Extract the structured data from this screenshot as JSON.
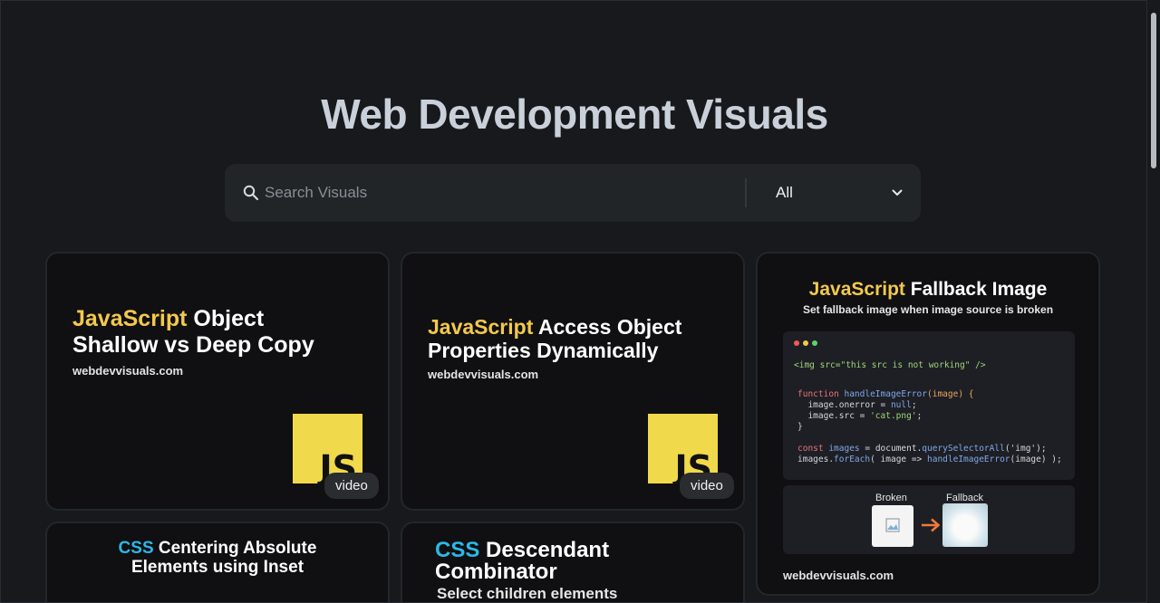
{
  "page": {
    "title": "Web Development Visuals"
  },
  "search": {
    "placeholder": "Search Visuals"
  },
  "filter": {
    "selected": "All"
  },
  "cards": [
    {
      "accent": "JavaScript",
      "title_line1_rest": " Object",
      "title_line2": "Shallow vs Deep Copy",
      "site": "webdevvisuals.com",
      "logo": "JS",
      "badge": "video"
    },
    {
      "accent": "JavaScript",
      "title_line1_rest": " Access Object",
      "title_line2": "Properties Dynamically",
      "site": "webdevvisuals.com",
      "logo": "JS",
      "badge": "video"
    },
    {
      "accent": "JavaScript",
      "title_rest": " Fallback Image",
      "subtitle": "Set fallback image when image source is broken",
      "code": {
        "l1": "<img src=\"this src is not working\" />",
        "l2a": "function ",
        "l2b": "handleImageError",
        "l2c": "(image) {",
        "l3a": "  image.onerror = ",
        "l3b": "null",
        "l3c": ";",
        "l4a": "  image.src = ",
        "l4b": "'cat.png'",
        "l4c": ";",
        "l5": "}",
        "l6a": "const ",
        "l6b": "images",
        "l6c": " = document.",
        "l6d": "querySelectorAll",
        "l6e": "('img');",
        "l7a": "images.",
        "l7b": "forEach",
        "l7c": "( image => ",
        "l7d": "handleImageError",
        "l7e": "(image) );"
      },
      "demo_broken": "Broken",
      "demo_fallback": "Fallback",
      "site": "webdevvisuals.com"
    },
    {
      "accent": "CSS",
      "title_line1_rest": " Centering Absolute",
      "title_line2": "Elements using Inset"
    },
    {
      "accent": "CSS",
      "title_line1_rest": " Descendant",
      "title_line2": "Combinator",
      "subtitle": "Select children elements"
    }
  ],
  "colors": {
    "js_accent": "#f2c94c",
    "css_accent": "#2bb8e6",
    "background": "#17191c"
  }
}
